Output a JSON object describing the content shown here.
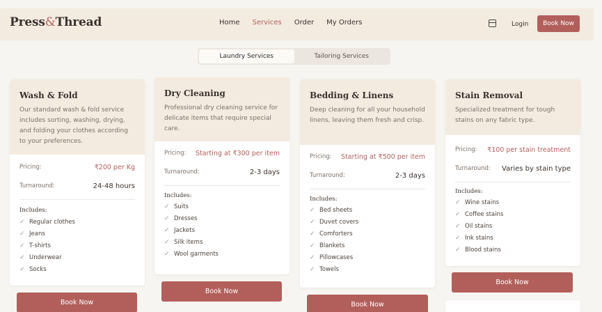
{
  "brand": {
    "part1": "Press",
    "amp": "&",
    "part2": "Thread"
  },
  "nav": {
    "links": [
      "Home",
      "Services",
      "Order",
      "My Orders"
    ],
    "login": "Login",
    "book_now": "Book Now"
  },
  "tabs": [
    "Laundry Services",
    "Tailoring Services"
  ],
  "cards": [
    {
      "title": "Wash & Fold",
      "desc": "Our standard wash & fold service includes sorting, washing, drying, and folding your clothes according to your preferences.",
      "pricing_label": "Pricing:",
      "pricing": "₹200 per Kg",
      "turnaround_label": "Turnaround:",
      "turnaround": "24-48 hours",
      "includes_label": "Includes:",
      "items": [
        "Regular clothes",
        "Jeans",
        "T-shirts",
        "Underwear",
        "Socks"
      ],
      "button": "Book Now"
    },
    {
      "title": "Dry Cleaning",
      "desc": "Professional dry cleaning service for delicate items that require special care.",
      "pricing_label": "Pricing:",
      "pricing": "Starting at ₹300 per item",
      "turnaround_label": "Turnaround:",
      "turnaround": "2-3 days",
      "includes_label": "Includes:",
      "items": [
        "Suits",
        "Dresses",
        "Jackets",
        "Silk items",
        "Wool garments"
      ],
      "button": "Book Now"
    },
    {
      "title": "Bedding & Linens",
      "desc": "Deep cleaning for all your household linens, leaving them fresh and crisp.",
      "pricing_label": "Pricing:",
      "pricing": "Starting at ₹500 per item",
      "turnaround_label": "Turnaround:",
      "turnaround": "2-3 days",
      "includes_label": "Includes:",
      "items": [
        "Bed sheets",
        "Duvet covers",
        "Comforters",
        "Blankets",
        "Pillowcases",
        "Towels"
      ],
      "button": "Book Now"
    },
    {
      "title": "Stain Removal",
      "desc": "Specialized treatment for tough stains on any fabric type.",
      "pricing_label": "Pricing:",
      "pricing": "₹100 per stain treatment",
      "turnaround_label": "Turnaround:",
      "turnaround": "Varies by stain type",
      "includes_label": "Includes:",
      "items": [
        "Wine stains",
        "Coffee stains",
        "Oil stains",
        "Ink stains",
        "Blood stains"
      ],
      "button": "Book Now"
    }
  ],
  "colors": {
    "accent": "#b25f5b",
    "header_bg": "#f3ebe0",
    "page_bg": "#f7f5f1"
  }
}
